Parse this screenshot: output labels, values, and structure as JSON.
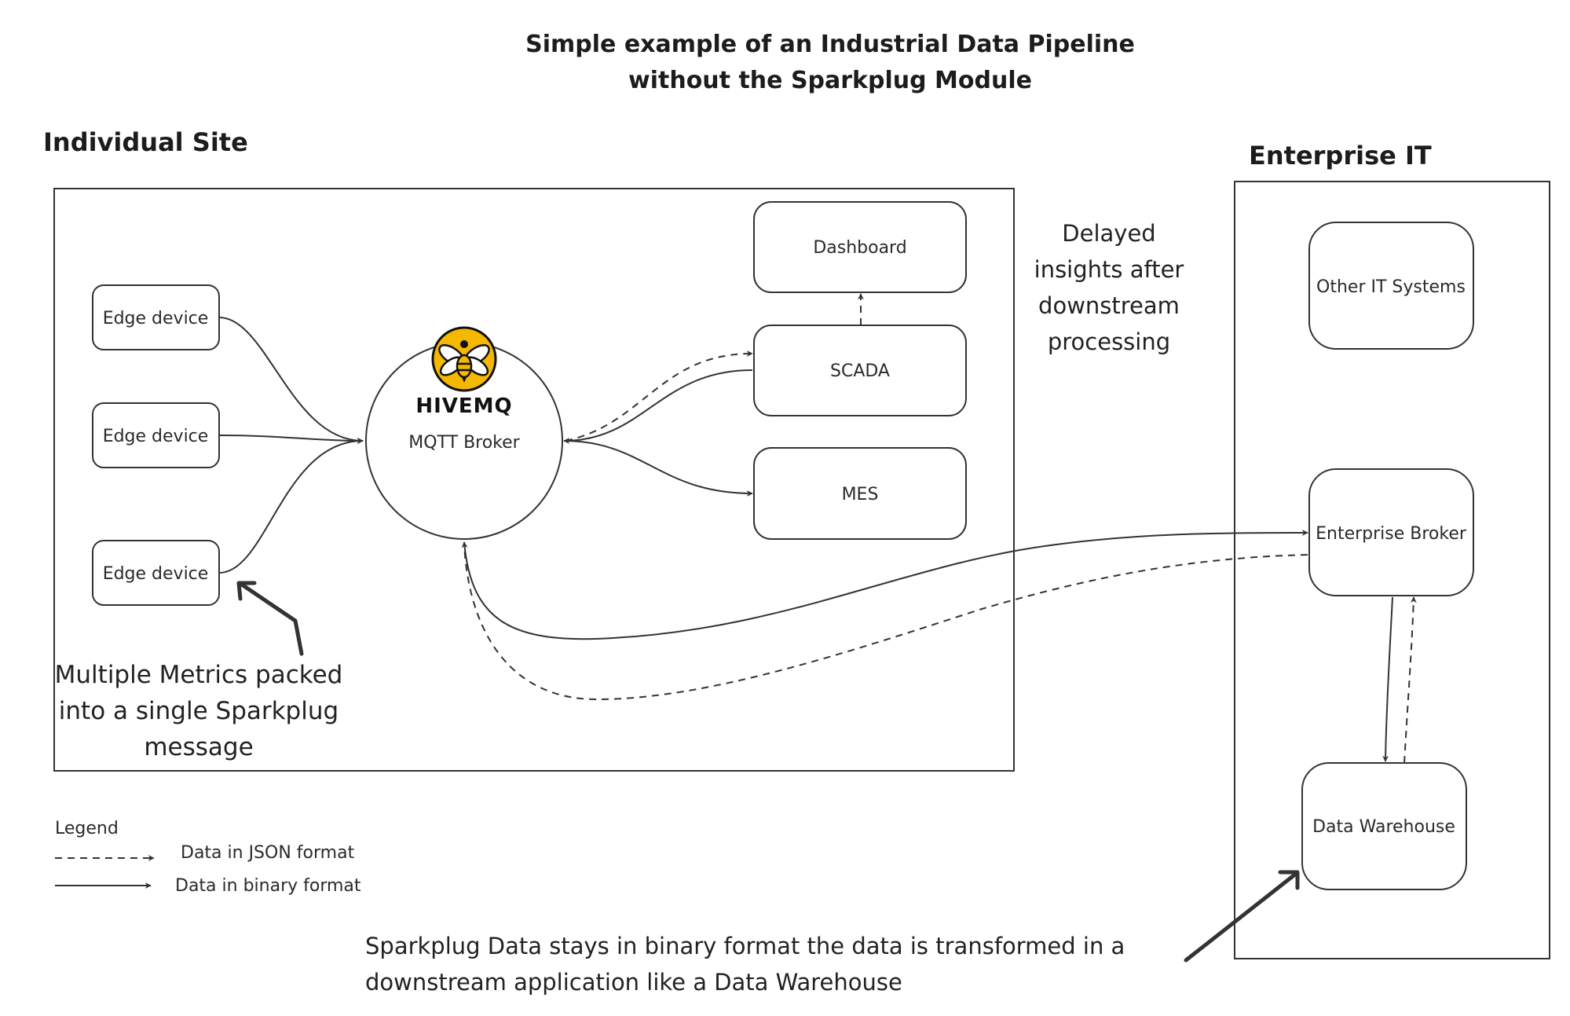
{
  "title": {
    "line1": "Simple example of an Industrial Data Pipeline",
    "line2": "without the Sparkplug Module"
  },
  "sections": {
    "site": "Individual Site",
    "enterprise": "Enterprise IT"
  },
  "nodes": {
    "edge1": "Edge device",
    "edge2": "Edge device",
    "edge3": "Edge device",
    "broker_brand": "HIVEMQ",
    "broker": "MQTT Broker",
    "dashboard": "Dashboard",
    "scada": "SCADA",
    "mes": "MES",
    "other_it": "Other IT Systems",
    "enterprise_broker": "Enterprise Broker",
    "data_warehouse": "Data Warehouse"
  },
  "annotations": {
    "delayed": [
      "Delayed",
      "insights after",
      "downstream",
      "processing"
    ],
    "metrics": [
      "Multiple Metrics packed",
      "into a single Sparkplug",
      "message"
    ],
    "sparkplug": [
      "Sparkplug Data stays in binary format the data is transformed in a",
      "downstream application like a Data Warehouse"
    ]
  },
  "legend": {
    "title": "Legend",
    "json": "Data in JSON format",
    "binary": "Data in binary format"
  },
  "colors": {
    "logo_yellow": "#F5B800",
    "stroke": "#333333"
  }
}
